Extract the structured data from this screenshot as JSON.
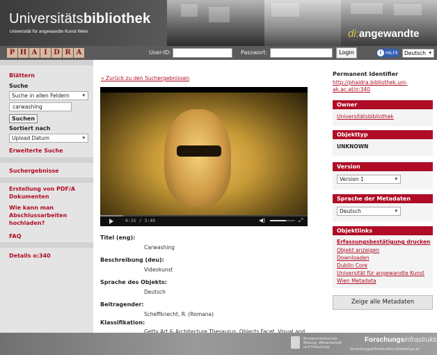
{
  "header": {
    "title_regular": "Universitäts",
    "title_bold": "bibliothek",
    "subtitle": "Universität für angewandte Kunst Wien",
    "brand_italic": "di:",
    "brand_bold": "angewandte"
  },
  "loginbar": {
    "logo_letters": [
      "P",
      "H",
      "A",
      "I",
      "D",
      "R",
      "A"
    ],
    "userid_label": "User-ID:",
    "password_label": "Passwort:",
    "login_button": "Login",
    "help_label": "HILFE",
    "language": "Deutsch"
  },
  "sidebar": {
    "browse": "Blättern",
    "search_label": "Suche",
    "search_scope": "Suche in allen Feldern",
    "search_value": "carwashing",
    "search_button": "Suchen",
    "sort_label": "Sortiert nach",
    "sort_value": "Upload Datum",
    "advanced_search": "Erweiterte Suche",
    "results": "Suchergebnisse",
    "pdf": "Erstellung von PDF/A Dokumenten",
    "thesis": "Wie kann man Abschlussarbeiten hochladen?",
    "faq": "FAQ",
    "details": "Details o:340"
  },
  "main": {
    "back_link": "« Zurück zu den Suchergebnissen",
    "video": {
      "time_current": "0:25",
      "time_total": "3:49",
      "progress": 0.11,
      "volume": 0.65
    },
    "fields": [
      {
        "label": "Titel (eng):",
        "value": "Carwashing"
      },
      {
        "label": "Beschreibung (deu):",
        "value": "Videokunst"
      },
      {
        "label": "Sprache des Objekts:",
        "value": "Deutsch"
      },
      {
        "label": "Beitragender:",
        "value": "Scheffknecht, R. (Romana)"
      },
      {
        "label": "Klassifikation:",
        "value": "Getty Art & Architecture Thesaurus, Objects Facet, Visual and Verbal Communication, Visual Works, Oeuvres Visuelles, visual works, oeuvres visuelles, oeuvre visuelle, visual works by medium or technique, time-based works, video art, art, video"
      }
    ]
  },
  "right": {
    "pid_label": "Permanent Identifier",
    "pid_link": "http://phaidra.bibliothek.uni-ak.ac.at/o:340",
    "owner_head": "Owner",
    "owner_value": "Universitätsbibliothek",
    "type_head": "Objekttyp",
    "type_value": "UNKNOWN",
    "version_head": "Version",
    "version_value": "Version 1",
    "meta_lang_head": "Sprache der Metadaten",
    "meta_lang_value": "Deutsch",
    "links_head": "Objektlinks",
    "links": [
      "Erfassungsbestätigung drucken",
      "Objekt anzeigen",
      "Downloaden",
      "Dublin Core",
      "Universität für angewandte Kunst",
      "Wien Metadata"
    ],
    "show_all": "Zeige alle Metadaten"
  },
  "footer": {
    "ministry": "Bundesministerium Bildung, Wissenschaft und Forschung",
    "fi_bold": "Forschungs",
    "fi_italic": "infrastruktur",
    "fi_url": "forschungsinfrastruktur.bmbwf.gv.at"
  }
}
